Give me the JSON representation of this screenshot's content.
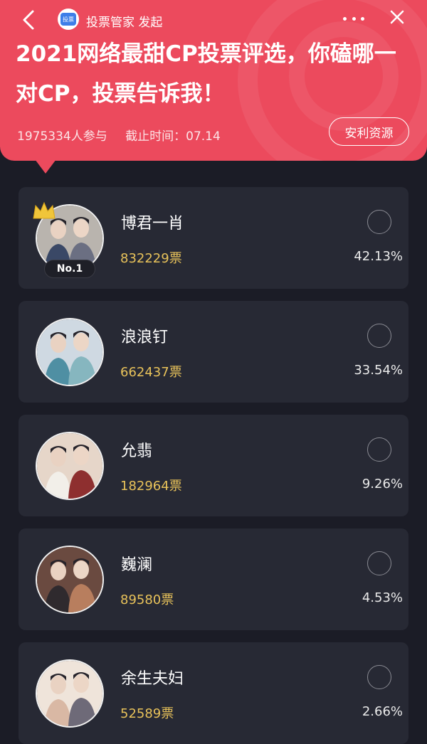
{
  "header": {
    "source_label": "投票管家 发起",
    "source_logo_text": "投票",
    "title": "2021网络最甜CP投票评选，你磕哪一对CP，投票告诉我！",
    "participants": "1975334人参与",
    "deadline": "截止时间：07.14",
    "resource_button": "安利资源",
    "accent_color": "#ec4a5d"
  },
  "candidates": [
    {
      "name": "博君一肖",
      "votes": "832229票",
      "percent": "42.13%",
      "rank": "No.1",
      "avatar_colors": [
        "#b9b4ae",
        "#3a4866",
        "#6b6f82"
      ]
    },
    {
      "name": "浪浪钉",
      "votes": "662437票",
      "percent": "33.54%",
      "avatar_colors": [
        "#cfd9e2",
        "#4f8fa3",
        "#86b6bf"
      ]
    },
    {
      "name": "允翡",
      "votes": "182964票",
      "percent": "9.26%",
      "avatar_colors": [
        "#e6d6c9",
        "#f2efe9",
        "#8e2f2f"
      ]
    },
    {
      "name": "巍澜",
      "votes": "89580票",
      "percent": "4.53%",
      "avatar_colors": [
        "#6a4a40",
        "#2f2a2e",
        "#b87e5e"
      ]
    },
    {
      "name": "余生夫妇",
      "votes": "52589票",
      "percent": "2.66%",
      "avatar_colors": [
        "#efe4da",
        "#d9b8a4",
        "#6e6a78"
      ]
    }
  ],
  "vote_color": "#e8c25a"
}
